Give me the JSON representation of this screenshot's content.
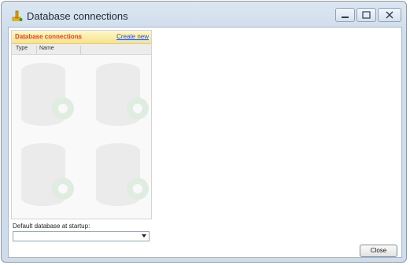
{
  "window": {
    "title": "Database connections",
    "icon": "database-app-icon"
  },
  "caption_buttons": {
    "minimize_icon": "minimize-icon",
    "maximize_icon": "maximize-icon",
    "close_icon": "close-icon"
  },
  "panel": {
    "title": "Database connections",
    "create_link": "Create new",
    "columns": [
      "Type",
      "Name"
    ],
    "watermark_icon": "database-gear-icon"
  },
  "default_db": {
    "label": "Default database at startup:",
    "value": ""
  },
  "footer": {
    "close_label": "Close"
  },
  "colors": {
    "panel_title": "#e2461a",
    "link": "#2a4fc0",
    "header_bg": "#f7e38a"
  }
}
